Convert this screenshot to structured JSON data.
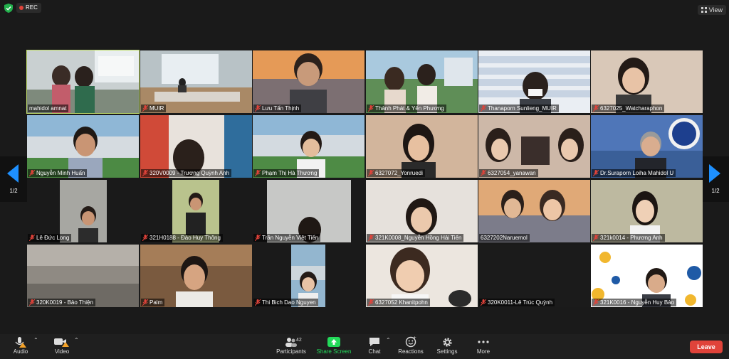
{
  "recording": {
    "label": "REC"
  },
  "view_button": {
    "label": "View"
  },
  "pagination": {
    "left": "1/2",
    "right": "1/2"
  },
  "participants": [
    {
      "name": "mahidol amnat",
      "muted": false,
      "active": true
    },
    {
      "name": "MUIR",
      "muted": true
    },
    {
      "name": "Lưu Tấn Thịnh",
      "muted": true
    },
    {
      "name": "Thành Phát & Yến Phương",
      "muted": true
    },
    {
      "name": "Thanaporn Sunlieng_MUIR",
      "muted": true
    },
    {
      "name": "6327025_Watcharaphon",
      "muted": true
    },
    {
      "name": "Nguyễn Minh Huấn",
      "muted": true
    },
    {
      "name": "320V0009 - Trương Quỳnh Anh",
      "muted": true
    },
    {
      "name": "Phạm Thị Hà Thương",
      "muted": true
    },
    {
      "name": "6327072_Yonruedi",
      "muted": true
    },
    {
      "name": "6327054_yanawan",
      "muted": true
    },
    {
      "name": "Dr.Suraporn Loiha Mahidol U",
      "muted": true
    },
    {
      "name": "Lê Đức Long",
      "muted": true
    },
    {
      "name": "321H0188 - Đào Huy Thông",
      "muted": true
    },
    {
      "name": "Trần Nguyễn Việt Tiến",
      "muted": true
    },
    {
      "name": "321K0008_Nguyễn Hồng Hải Tiến",
      "muted": true
    },
    {
      "name": "6327202Naruemol",
      "muted": false
    },
    {
      "name": "321k0014 - Phương Anh",
      "muted": true
    },
    {
      "name": "320K0019 - Bảo Thiện",
      "muted": true
    },
    {
      "name": "Palm",
      "muted": true
    },
    {
      "name": "Thi Bich Dao Nguyen",
      "muted": true
    },
    {
      "name": "6327052 Khanitpohn",
      "muted": true
    },
    {
      "name": "320K0011-Lê Trúc Quỳnh",
      "muted": true
    },
    {
      "name": "321K0016 - Nguyễn Huy Bảo",
      "muted": true
    }
  ],
  "toolbar": {
    "audio": "Audio",
    "video": "Video",
    "participants": "Participants",
    "participants_count": "42",
    "share_screen": "Share Screen",
    "chat": "Chat",
    "reactions": "Reactions",
    "settings": "Settings",
    "more": "More",
    "leave": "Leave"
  },
  "colors": {
    "accent_green": "#23d95a",
    "leave_red": "#e0433a",
    "speaker_outline": "#c3e06c",
    "arrow_blue": "#1e90ff"
  }
}
